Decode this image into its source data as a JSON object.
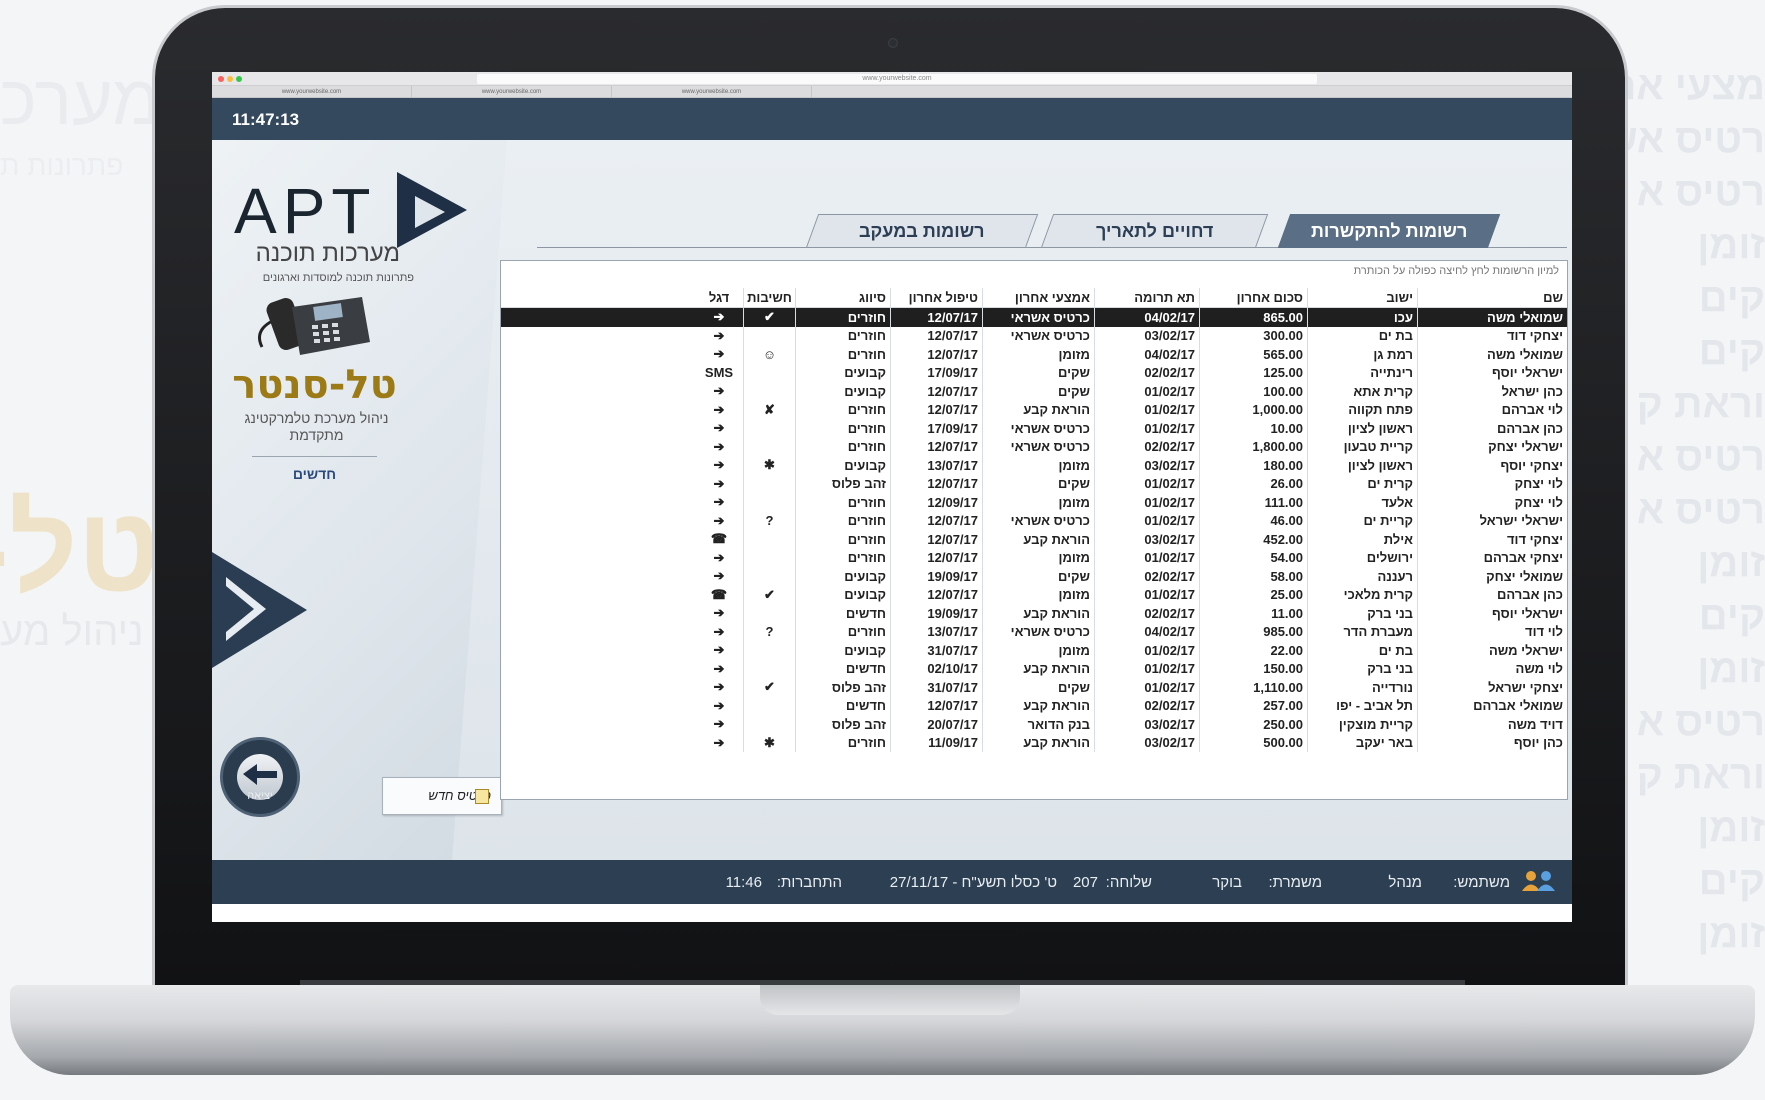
{
  "clock": "11:47:13",
  "browser": {
    "url": "www.yourwebsite.com",
    "tabs": [
      "www.yourwebsite.com",
      "www.yourwebsite.com",
      "www.yourwebsite.com"
    ]
  },
  "background": {
    "left_title": "מערכ",
    "left_sub": "פתרונות ת",
    "tel": "טל-",
    "nihul": "ניהול מע",
    "right_words": [
      "מצעי אר",
      "רטיס אש",
      "רטיס א",
      "זומן",
      "קים",
      "קים",
      "וראת ק",
      "רטיס א",
      "רטיס א",
      "זומן",
      "קים",
      "זומן",
      "רטיס א",
      "וראת ק",
      "זומן",
      "קים",
      "זומן"
    ]
  },
  "sidebar": {
    "logo_apt": "APT",
    "logo_sub": "מערכות תוכנה",
    "logo_sub2": "פתרונות תוכנה למוסדות וארגונים",
    "product_title": "טל-סנטר",
    "product_sub": "ניהול מערכת טלמרקטינג מתקדמת",
    "new_link": "חדשים",
    "exit_label": "יציאה",
    "new_card_label": "כרטיס חדש"
  },
  "tabs": [
    {
      "label": "רשומות להתקשרות",
      "active": true
    },
    {
      "label": "דחויים לתאריך",
      "active": false
    },
    {
      "label": "רשומות במעקב",
      "active": false
    }
  ],
  "hint": "למיון הרשומות לחץ לחיצה כפולה על הכותרת",
  "table": {
    "headers": [
      "שם",
      "ישוב",
      "סכום אחרון",
      "תא תרומה",
      "אמצעי אחרון",
      "טיפול אחרון",
      "סיווג",
      "חשיבות",
      "דגל"
    ],
    "rows": [
      [
        "שמואלי משה",
        "עכו",
        "865.00",
        "04/02/17",
        "כרטיס אשראי",
        "12/07/17",
        "חוזרים",
        "✔",
        "➔"
      ],
      [
        "יצחקי דוד",
        "בת ים",
        "300.00",
        "03/02/17",
        "כרטיס אשראי",
        "12/07/17",
        "חוזרים",
        "",
        "➔"
      ],
      [
        "שמואלי משה",
        "רמת גן",
        "565.00",
        "04/02/17",
        "מזומן",
        "12/07/17",
        "חוזרים",
        "☺",
        "➔"
      ],
      [
        "ישראלי יוסף",
        "רינתייה",
        "125.00",
        "02/02/17",
        "שקים",
        "17/09/17",
        "קבועים",
        "",
        "SMS"
      ],
      [
        "כהן ישראל",
        "קרית אתא",
        "100.00",
        "01/02/17",
        "שקים",
        "12/07/17",
        "קבועים",
        "",
        "➔"
      ],
      [
        "לוי אברהם",
        "פתח תקווה",
        "1,000.00",
        "01/02/17",
        "הוראת קבע",
        "12/07/17",
        "חוזרים",
        "✘",
        "➔"
      ],
      [
        "כהן אברהם",
        "ראשון לציון",
        "10.00",
        "01/02/17",
        "כרטיס אשראי",
        "17/09/17",
        "חוזרים",
        "",
        "➔"
      ],
      [
        "ישראלי יצחק",
        "קריית טבעון",
        "1,800.00",
        "02/02/17",
        "כרטיס אשראי",
        "12/07/17",
        "חוזרים",
        "",
        "➔"
      ],
      [
        "יצחקי יוסף",
        "ראשון לציון",
        "180.00",
        "03/02/17",
        "מזומן",
        "13/07/17",
        "קבועים",
        "✱",
        "➔"
      ],
      [
        "לוי יצחק",
        "קרית ים",
        "26.00",
        "01/02/17",
        "שקים",
        "12/07/17",
        "זהב פלוס",
        "",
        "➔"
      ],
      [
        "לוי יצחק",
        "אלעד",
        "111.00",
        "01/02/17",
        "מזומן",
        "12/09/17",
        "חוזרים",
        "",
        "➔"
      ],
      [
        "ישראלי ישראל",
        "קריית ים",
        "46.00",
        "01/02/17",
        "כרטיס אשראי",
        "12/07/17",
        "חוזרים",
        "?",
        "➔"
      ],
      [
        "יצחקי דוד",
        "אילת",
        "452.00",
        "03/02/17",
        "הוראת קבע",
        "12/07/17",
        "חוזרים",
        "",
        "☎"
      ],
      [
        "יצחקי אברהם",
        "ירושלים",
        "54.00",
        "01/02/17",
        "מזומן",
        "12/07/17",
        "חוזרים",
        "",
        "➔"
      ],
      [
        "שמואלי יצחק",
        "רעננה",
        "58.00",
        "02/02/17",
        "שקים",
        "19/09/17",
        "קבועים",
        "",
        "➔"
      ],
      [
        "כהן אברהם",
        "קרית מלאכי",
        "25.00",
        "01/02/17",
        "מזומן",
        "12/07/17",
        "קבועים",
        "✔",
        "☎"
      ],
      [
        "ישראלי יוסף",
        "בני ברק",
        "11.00",
        "02/02/17",
        "הוראת קבע",
        "19/09/17",
        "חדשים",
        "",
        "➔"
      ],
      [
        "לוי דוד",
        "מעברת הדר",
        "985.00",
        "04/02/17",
        "כרטיס אשראי",
        "13/07/17",
        "חוזרים",
        "?",
        "➔"
      ],
      [
        "ישראלי משה",
        "בת ים",
        "22.00",
        "01/02/17",
        "מזומן",
        "31/07/17",
        "קבועים",
        "",
        "➔"
      ],
      [
        "לוי משה",
        "בני ברק",
        "150.00",
        "01/02/17",
        "הוראת קבע",
        "02/10/17",
        "חדשים",
        "",
        "➔"
      ],
      [
        "יצחקי ישראל",
        "נורדייה",
        "1,110.00",
        "01/02/17",
        "שקים",
        "31/07/17",
        "זהב פלוס",
        "✔",
        "➔"
      ],
      [
        "שמואלי אברהם",
        "תל אביב - יפו",
        "257.00",
        "02/02/17",
        "הוראת קבע",
        "12/07/17",
        "חדשים",
        "",
        "➔"
      ],
      [
        "דויד משה",
        "קריית מוצקין",
        "250.00",
        "03/02/17",
        "בנק הדואר",
        "20/07/17",
        "זהב פלוס",
        "",
        "➔"
      ],
      [
        "כהן יוסף",
        "באר יעקב",
        "500.00",
        "03/02/17",
        "הוראת קבע",
        "11/09/17",
        "חוזרים",
        "✱",
        "➔"
      ]
    ]
  },
  "status": {
    "user_label": "משתמש:",
    "user_value": "מנהל",
    "shift_label": "משמרת:",
    "shift_value": "בוקר",
    "ext_label": "שלוחה:",
    "ext_value": "207",
    "date_value": "ט' כסלו תשע\"ח - 27/11/17",
    "login_label": "התחברות:",
    "login_value": "11:46"
  },
  "colors": {
    "header_bar": "#34495e",
    "active_tab": "#5a6e86",
    "gold": "#9c7a16",
    "selected_row": "#1f1f1f"
  }
}
